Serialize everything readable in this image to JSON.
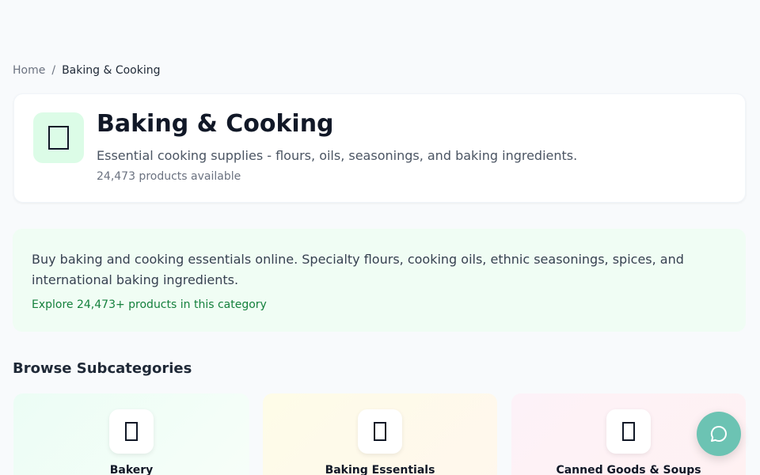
{
  "breadcrumb": {
    "home": "Home",
    "separator": "/",
    "current": "Baking & Cooking"
  },
  "category": {
    "icon": "category-placeholder-icon",
    "title": "Baking & Cooking",
    "description": "Essential cooking supplies - flours, oils, seasonings, and baking ingredients.",
    "product_count": "24,473 products available"
  },
  "seo": {
    "text": "Buy baking and cooking essentials online. Specialty flours, cooking oils, ethnic seasonings, spices, and international baking ingredients.",
    "explore": "Explore 24,473+ products in this category"
  },
  "subcategories": {
    "heading": "Browse Subcategories",
    "items": [
      {
        "label": "Bakery",
        "icon": "bakery-icon",
        "color": "#ecfdf5"
      },
      {
        "label": "Baking Essentials",
        "icon": "baking-essentials-icon",
        "color": "#fefce8"
      },
      {
        "label": "Canned Goods & Soups",
        "icon": "canned-goods-icon",
        "color": "#fdf2f8"
      }
    ]
  },
  "chat": {
    "icon": "chat-bubble-icon",
    "color": "#6cc3b3"
  },
  "colors": {
    "accent_green": "#15803d",
    "seo_background": "#f0fdf4",
    "icon_background": "#dcfce7"
  }
}
